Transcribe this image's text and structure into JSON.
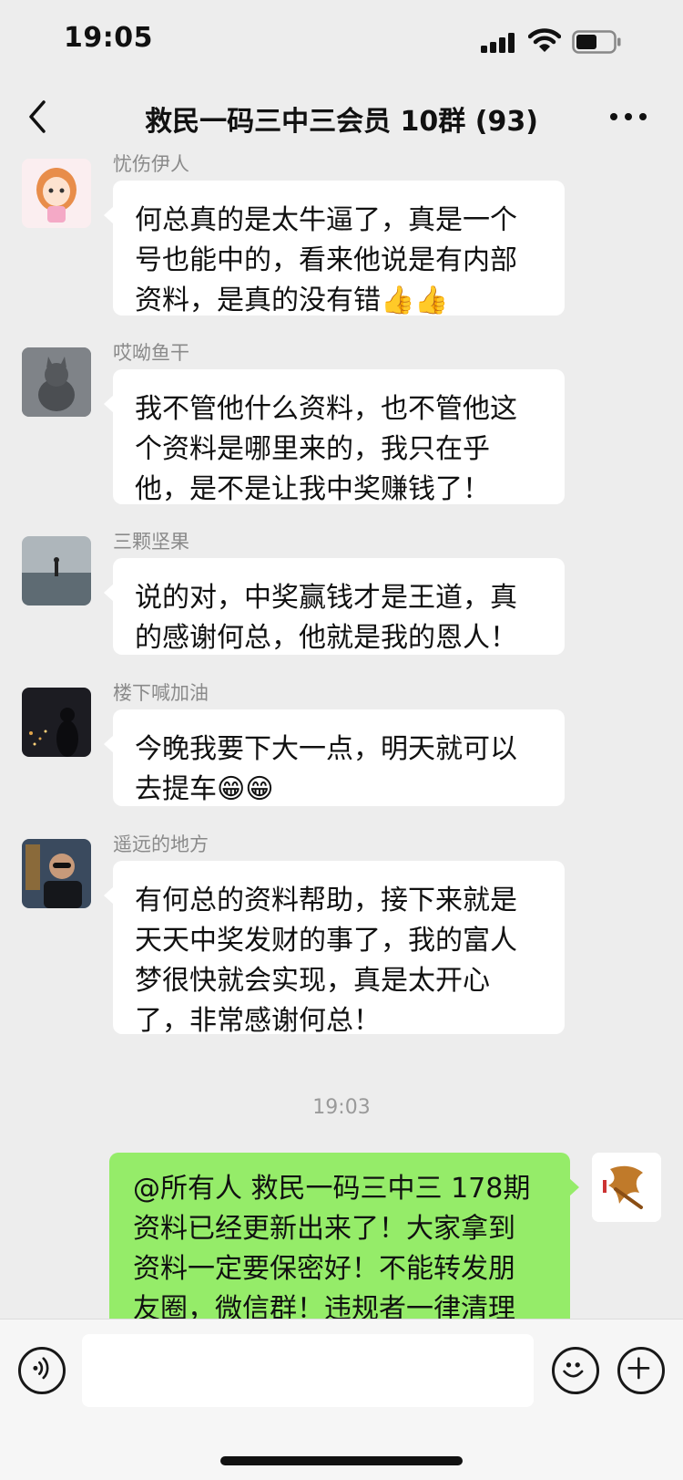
{
  "status_bar": {
    "time": "19:05",
    "battery_level": 0.55
  },
  "nav": {
    "title": "救民一码三中三会员 10群 (93)",
    "back_icon": "chevron-left-icon",
    "more_icon": "more-dots-icon"
  },
  "messages": [
    {
      "sender": "忧伤伊人",
      "avatar_icon": "avatar-cartoon-girl",
      "lines": [
        "何总真的是太牛逼了，真是一个",
        "号也能中的，看来他说是有内部",
        "资料，是真的没有错👍👍"
      ]
    },
    {
      "sender": "哎呦鱼干",
      "avatar_icon": "avatar-cat",
      "lines": [
        "我不管他什么资料，也不管他这",
        "个资料是哪里来的，我只在乎",
        "他，是不是让我中奖赚钱了！"
      ]
    },
    {
      "sender": "三颗坚果",
      "avatar_icon": "avatar-seaside",
      "lines": [
        "说的对，中奖赢钱才是王道，真",
        "的感谢何总，他就是我的恩人！"
      ]
    },
    {
      "sender": "楼下喊加油",
      "avatar_icon": "avatar-night-city",
      "lines": [
        "今晚我要下大一点，明天就可以",
        "去提车😁😁"
      ]
    },
    {
      "sender": "遥远的地方",
      "avatar_icon": "avatar-man-sunglasses",
      "lines": [
        "有何总的资料帮助，接下来就是",
        "天天中奖发财的事了，我的富人",
        "梦很快就会实现，真是太开心",
        "了，非常感谢何总！"
      ]
    }
  ],
  "timestamp": "19:03",
  "outgoing": {
    "avatar_icon": "avatar-calligraphy",
    "lines": [
      "@所有人  救民一码三中三 178期",
      "资料已经更新出来了！大家拿到",
      "资料一定要保密好！不能转发朋",
      "友圈，微信群！违规者一律清理"
    ]
  },
  "input_bar": {
    "voice_icon": "voice-icon",
    "emoji_icon": "emoji-icon",
    "plus_icon": "plus-icon",
    "placeholder": ""
  },
  "colors": {
    "background": "#ededed",
    "incoming_bubble": "#ffffff",
    "outgoing_bubble": "#95ec69"
  }
}
